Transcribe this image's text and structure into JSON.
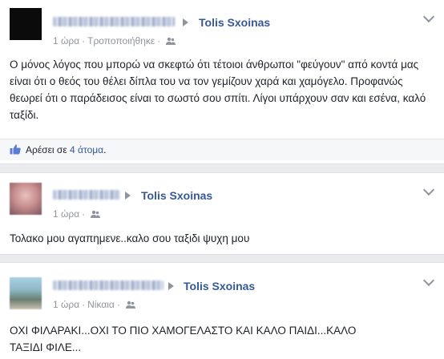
{
  "posts": [
    {
      "recipient": "Tolis Sxoinas",
      "time": "1 ώρα",
      "edited": "Τροποποιήθηκε",
      "text": "Ο μόνος λόγος που μπορώ να σκεφτώ ότι τέτοιοι άνθρωποι \"φεύγουν\" από κοντά μας είναι ότι ο θεός του θέλει δίπλα του να τον γεμίζουν χαρά και χαμόγελο. Προφανώς θεωρεί ότι ο παράδεισος είναι το σωστό σου σπίτι. Λίγοι υπάρχουν σαν και εσένα, καλό ταξίδι.",
      "likes_prefix": "Αρέσει σε",
      "likes_count": "4 άτομα",
      "likes_suffix": "."
    },
    {
      "recipient": "Tolis Sxoinas",
      "time": "1 ώρα",
      "text": "Τολακο μου αγαπημενε..καλο σου ταξιδι ψυχη μου"
    },
    {
      "recipient": "Tolis Sxoinas",
      "time": "1 ώρα",
      "location": "Νίκαια",
      "text": "ΟΧΙ ΦΙΛΑΡΑΚΙ...ΟΧΙ ΤΟ ΠΙΟ ΧΑΜΟΓΕΛΑΣΤΟ ΚΑΙ ΚΑΛΟ ΠΑΙΔΙ...ΚΑΛΟ ΤΑΞΙΔΙ ΦΙΛΕ..."
    }
  ],
  "colors": {
    "link": "#365899",
    "meta": "#90949c",
    "text": "#1d2129",
    "bg": "#e9ebee"
  }
}
